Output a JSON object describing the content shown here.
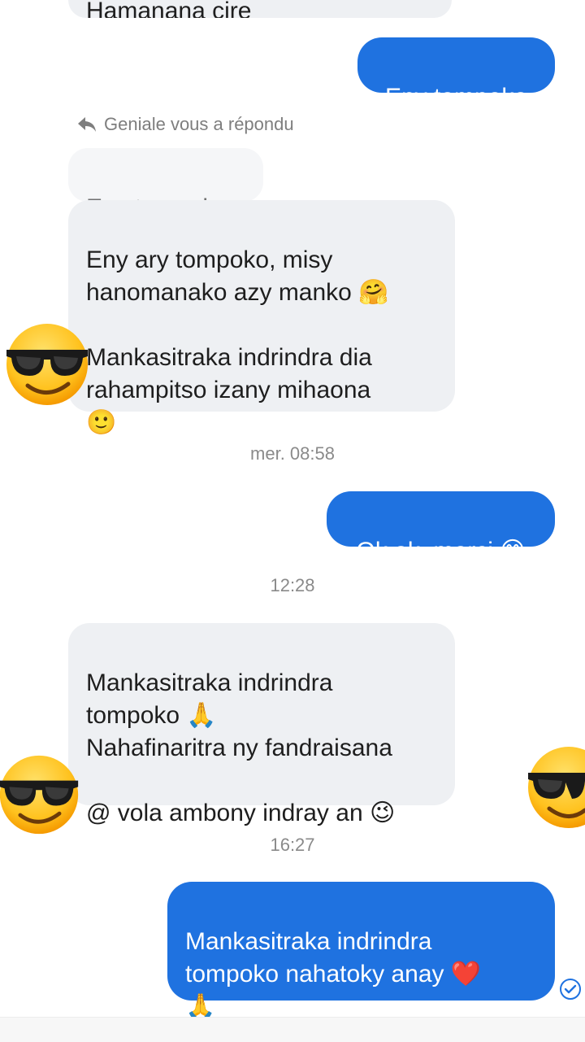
{
  "conversation": {
    "cut_message": "Hamanana cire",
    "msg_out_1": "Eny tompoko",
    "reply_note": "Geniale vous a répondu",
    "quoted": "Eny tompoko",
    "msg_in_1": "Eny ary tompoko, misy\nhanomanako azy manko 🤗\n\nMankasitraka indrindra dia\nrahampitso izany mihaona\n🙂",
    "time_1": "mer. 08:58",
    "msg_out_2": "Ok ok, merci 😊",
    "time_2": "12:28",
    "msg_in_2": "Mankasitraka indrindra\ntompoko 🙏\nNahafinaritra ny fandraisana\n\n@ vola ambony indray an 😉",
    "time_3": "16:27",
    "msg_out_3": "Mankasitraka indrindra\ntompoko nahatoky anay ❤️\n🙏"
  },
  "icons": {
    "reply": "reply-arrow-icon",
    "seen": "seen-check-icon",
    "sticker": "sunglasses-emoji-icon"
  },
  "colors": {
    "outgoing_bubble": "#1f72e0",
    "incoming_bubble": "#eef0f3",
    "timestamp": "#8a8a8a"
  }
}
